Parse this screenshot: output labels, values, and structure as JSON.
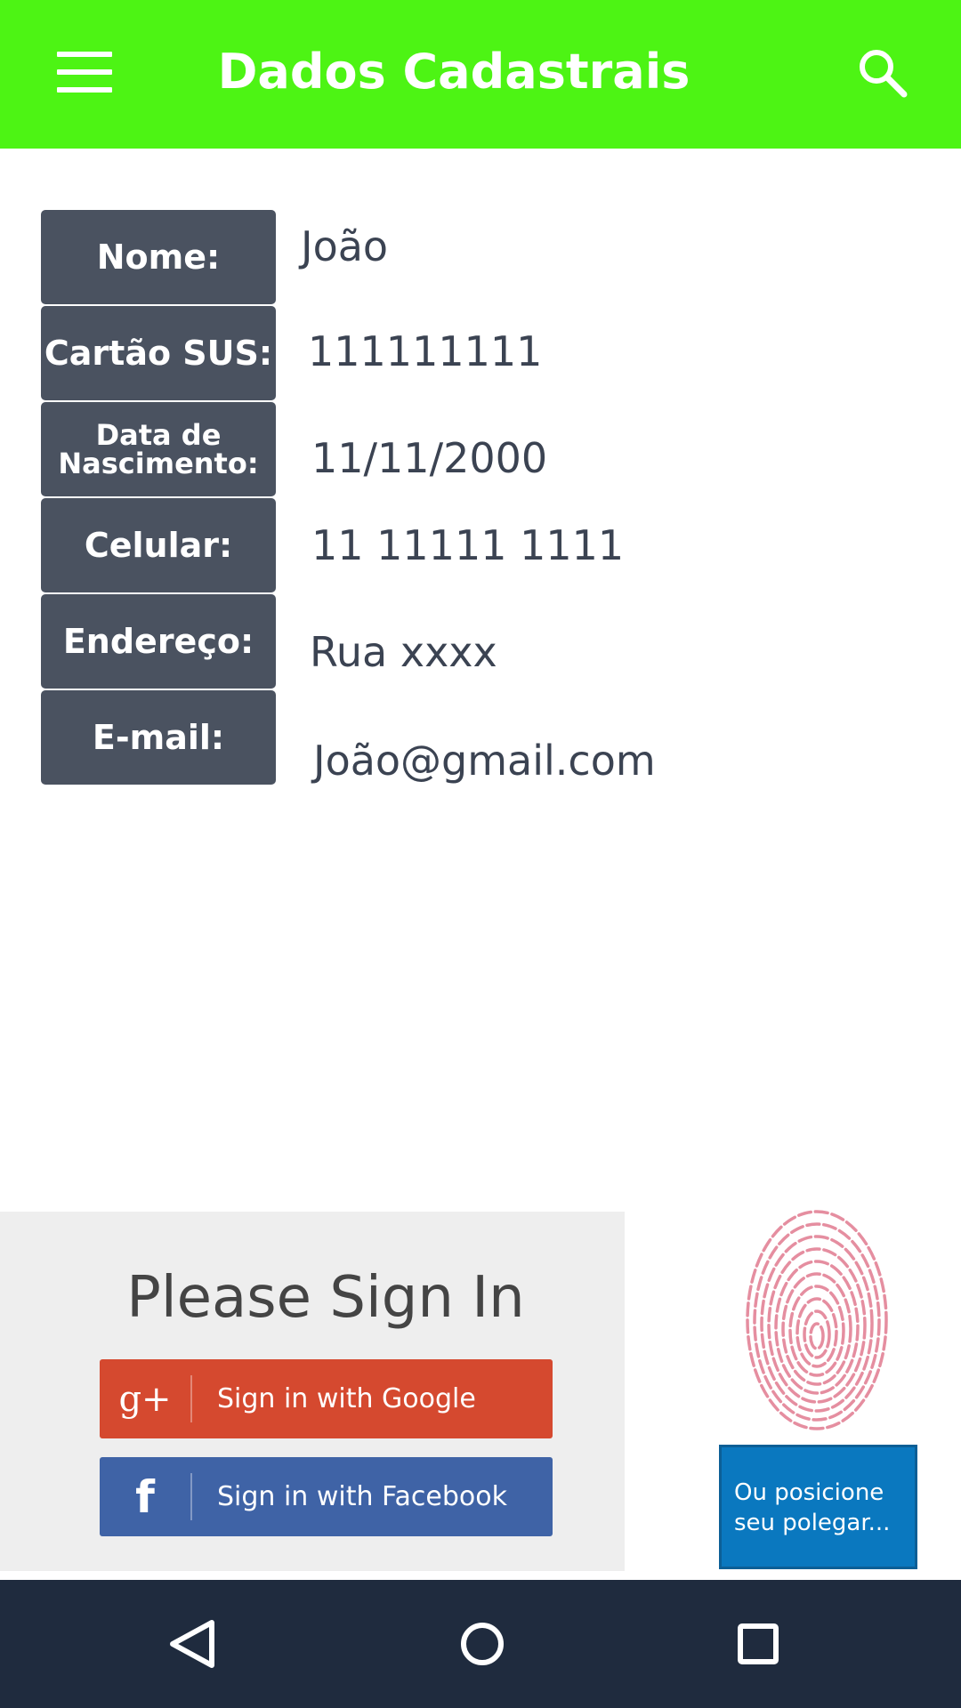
{
  "app_bar": {
    "title": "Dados Cadastrais",
    "menu_icon": "menu-icon",
    "search_icon": "search-icon",
    "background_color": "#4df414"
  },
  "profile": {
    "fields": [
      {
        "label": "Nome:",
        "value": "João"
      },
      {
        "label": "Cartão SUS:",
        "value": "111111111"
      },
      {
        "label": "Data de Nascimento:",
        "value": "11/11/2000"
      },
      {
        "label": "Celular:",
        "value": "11 11111 1111"
      },
      {
        "label": "Endereço:",
        "value": "Rua xxxx"
      },
      {
        "label": "E-mail:",
        "value": "João@gmail.com"
      }
    ],
    "label_color": "#4a5260"
  },
  "signin": {
    "title": "Please Sign In",
    "google_label": "Sign in with Google",
    "google_icon": "google-plus-icon",
    "google_icon_text": "g+",
    "google_color": "#d5492f",
    "facebook_label": "Sign in with Facebook",
    "facebook_icon": "facebook-icon",
    "facebook_icon_text": "f",
    "facebook_color": "#3f63a6"
  },
  "fingerprint": {
    "icon": "fingerprint-icon",
    "caption": "Ou posicione seu polegar...",
    "caption_color": "#0a78bf"
  },
  "nav_bar": {
    "back_icon": "back-icon",
    "home_icon": "home-icon",
    "recents_icon": "recents-icon"
  }
}
